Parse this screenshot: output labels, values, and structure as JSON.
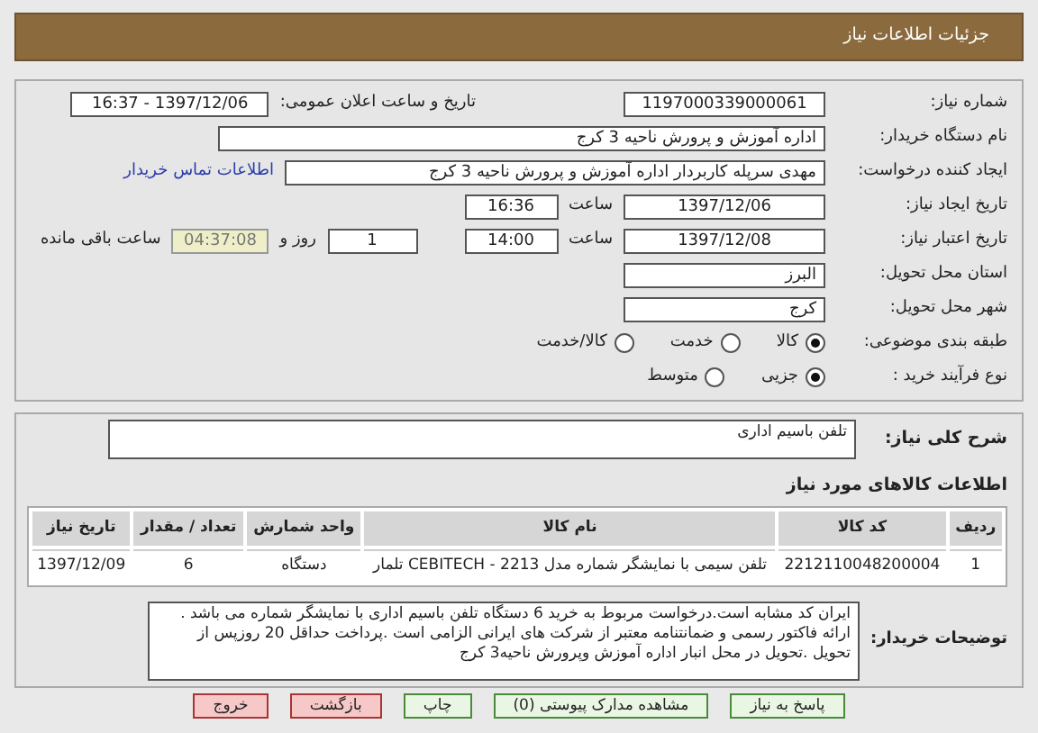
{
  "header": {
    "title": "جزئیات اطلاعات نیاز"
  },
  "need_number": {
    "label": "شماره نیاز:",
    "value": "1197000339000061"
  },
  "announce": {
    "label": "تاریخ و ساعت اعلان عمومی:",
    "value": "1397/12/06 - 16:37"
  },
  "buyer_org": {
    "label": "نام دستگاه خریدار:",
    "value": "اداره آموزش و پرورش ناحیه 3 کرج"
  },
  "requester": {
    "label": "ایجاد کننده درخواست:",
    "value": "مهدی سرپله کاربردار اداره آموزش و پرورش ناحیه 3 کرج",
    "link": "اطلاعات تماس خریدار"
  },
  "created": {
    "label": "تاریخ ایجاد نیاز:",
    "date": "1397/12/06",
    "time_label": "ساعت",
    "time": "16:36"
  },
  "validity": {
    "label": "تاریخ اعتبار نیاز:",
    "date": "1397/12/08",
    "time_label": "ساعت",
    "time": "14:00",
    "days": "1",
    "days_label": "روز و",
    "remaining": "04:37:08",
    "remaining_label": "ساعت باقی مانده"
  },
  "province": {
    "label": "استان محل تحویل:",
    "value": "البرز"
  },
  "city": {
    "label": "شهر محل تحویل:",
    "value": "کرج"
  },
  "category": {
    "label": "طبقه بندی موضوعی:",
    "options": [
      {
        "label": "کالا",
        "selected": true
      },
      {
        "label": "خدمت",
        "selected": false
      },
      {
        "label": "کالا/خدمت",
        "selected": false
      }
    ]
  },
  "process": {
    "label": "نوع فرآیند خرید :",
    "options": [
      {
        "label": "جزیی",
        "selected": true
      },
      {
        "label": "متوسط",
        "selected": false
      }
    ]
  },
  "summary": {
    "label": "شرح کلی نیاز:",
    "value": "تلفن باسیم اداری"
  },
  "goods_title": "اطلاعات کالاهای مورد نیاز",
  "table": {
    "columns": [
      "ردیف",
      "کد کالا",
      "نام کالا",
      "واحد شمارش",
      "تعداد / مقدار",
      "تاریخ نیاز"
    ],
    "rows": [
      [
        "1",
        "2212110048200004",
        "تلفن سیمی با نمایشگر شماره مدل 2213 - CEBITECH تلمار",
        "دستگاه",
        "6",
        "1397/12/09"
      ]
    ]
  },
  "notes": {
    "label": "توضیحات خریدار:",
    "value": "ایران کد مشابه است.درخواست مربوط به خرید 6 دستگاه تلفن باسیم اداری با نمایشگر شماره می باشد . ارائه فاکتور رسمی و ضمانتنامه معتبر از شرکت های ایرانی الزامی است .پرداخت حداقل 20 روزپس از تحویل .تحویل در محل انبار اداره آموزش وپرورش ناحیه3 کرج"
  },
  "buttons": [
    {
      "label": "پاسخ به نیاز",
      "kind": "go"
    },
    {
      "label": "مشاهده مدارک پیوستی (0)",
      "kind": "go"
    },
    {
      "label": "چاپ",
      "kind": "go"
    },
    {
      "label": "بازگشت",
      "kind": "back"
    },
    {
      "label": "خروج",
      "kind": "back"
    }
  ]
}
